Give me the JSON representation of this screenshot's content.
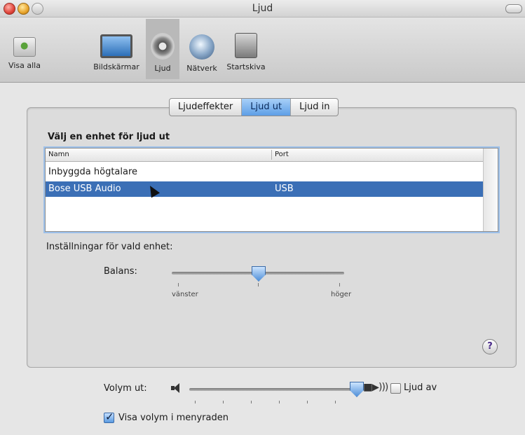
{
  "window": {
    "title": "Ljud"
  },
  "toolbar": {
    "items": [
      {
        "label": "Visa alla",
        "icon": "show-all-icon"
      },
      {
        "label": "Bildskärmar",
        "icon": "displays-icon"
      },
      {
        "label": "Ljud",
        "icon": "sound-icon",
        "selected": true
      },
      {
        "label": "Nätverk",
        "icon": "network-icon"
      },
      {
        "label": "Startskiva",
        "icon": "startup-disk-icon"
      }
    ]
  },
  "tabs": [
    {
      "label": "Ljudeffekter"
    },
    {
      "label": "Ljud ut",
      "active": true
    },
    {
      "label": "Ljud in"
    }
  ],
  "output": {
    "heading": "Välj en enhet för ljud ut",
    "columns": {
      "name": "Namn",
      "port": "Port"
    },
    "devices": [
      {
        "name": "Inbyggda högtalare",
        "port": ""
      },
      {
        "name": "Bose USB Audio",
        "port": "USB",
        "selected": true
      }
    ]
  },
  "settings": {
    "label": "Inställningar för vald enhet:",
    "balance_label": "Balans:",
    "balance_left": "vänster",
    "balance_right": "höger",
    "balance_value": 0.5
  },
  "volume": {
    "label": "Volym ut:",
    "value": 0.95,
    "mute_label": "Ljud av",
    "mute_checked": false,
    "menu_label": "Visa volym i menyraden",
    "menu_checked": true
  },
  "help": {
    "label": "?"
  },
  "colors": {
    "selection": "#3b6fb6",
    "accent": "#5d9ee6"
  }
}
